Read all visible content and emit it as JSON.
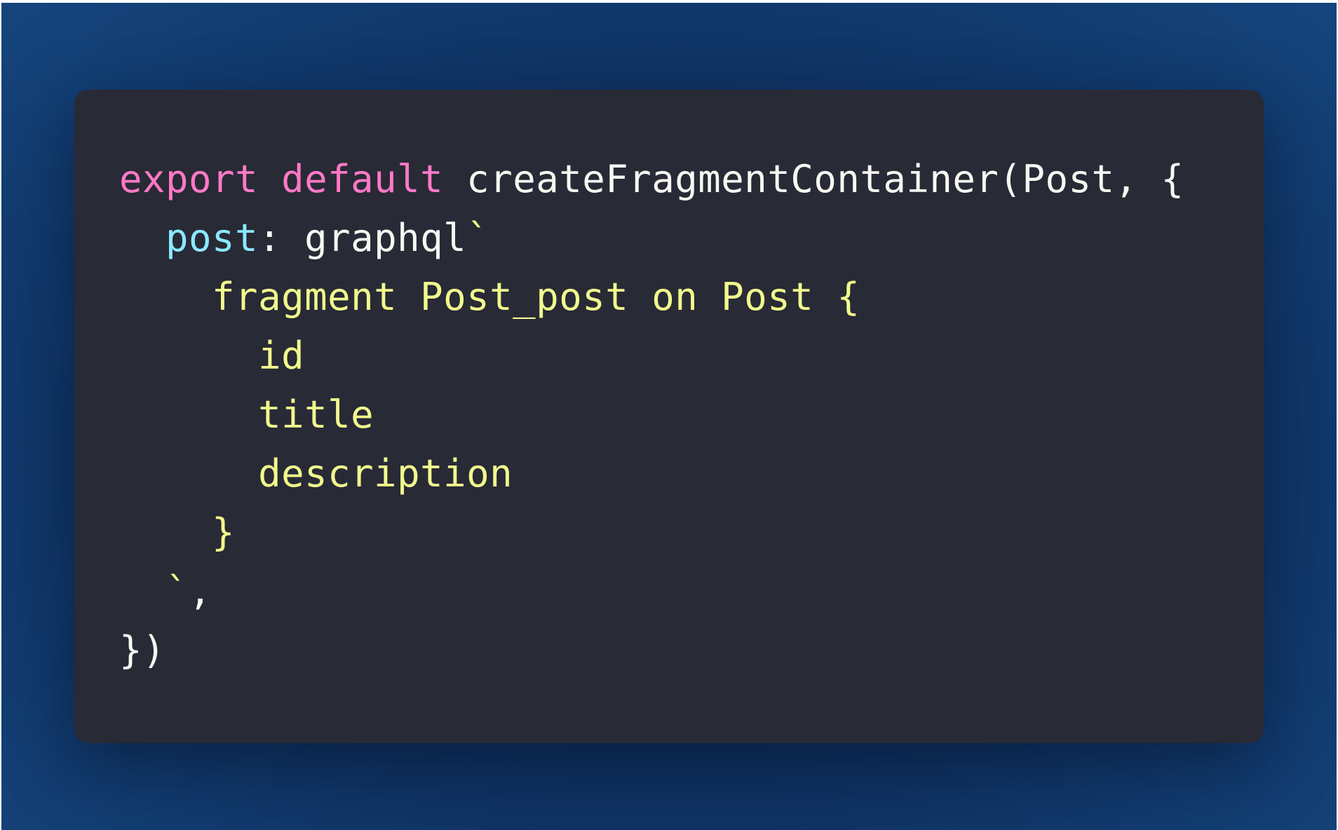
{
  "code": {
    "language": "javascript",
    "colors": {
      "keyword": "#ff79c6",
      "property": "#8be9fd",
      "string": "#f1fa8c",
      "plain": "#f8f8f2",
      "background": "#282a36"
    },
    "lines": [
      [
        {
          "t": "export",
          "c": "kw"
        },
        {
          "t": " ",
          "c": "plain"
        },
        {
          "t": "default",
          "c": "kw"
        },
        {
          "t": " createFragmentContainer(Post, {",
          "c": "plain"
        }
      ],
      [
        {
          "t": "  ",
          "c": "plain"
        },
        {
          "t": "post",
          "c": "prop"
        },
        {
          "t": ": graphql",
          "c": "plain"
        },
        {
          "t": "`",
          "c": "str"
        }
      ],
      [
        {
          "t": "    fragment Post_post on Post {",
          "c": "str"
        }
      ],
      [
        {
          "t": "      id",
          "c": "str"
        }
      ],
      [
        {
          "t": "      title",
          "c": "str"
        }
      ],
      [
        {
          "t": "      description",
          "c": "str"
        }
      ],
      [
        {
          "t": "    }",
          "c": "str"
        }
      ],
      [
        {
          "t": "  `",
          "c": "str"
        },
        {
          "t": ",",
          "c": "plain"
        }
      ],
      [
        {
          "t": "})",
          "c": "plain"
        }
      ]
    ]
  }
}
